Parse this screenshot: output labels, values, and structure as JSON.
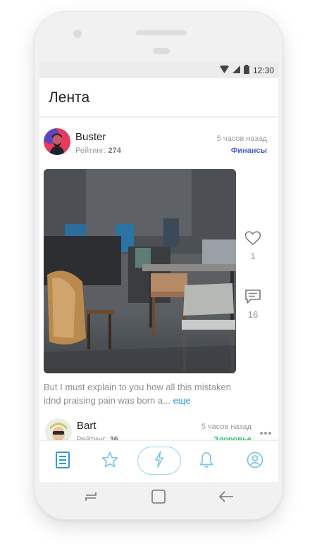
{
  "status": {
    "time": "12:30"
  },
  "header": {
    "title": "Лента"
  },
  "feed": {
    "posts": [
      {
        "author": "Buster",
        "rating_label": "Рейтинг:",
        "rating_value": "274",
        "time": "5 часов назад",
        "category": "Финансы",
        "category_color": "#4a5fd6",
        "likes": "1",
        "comments": "16",
        "excerpt": "But I must explain to you how all this mistaken idnd praising pain was born a...",
        "more": "еще"
      },
      {
        "author": "Bart",
        "rating_label": "Рейтинг:",
        "rating_value": "36",
        "time": "5 часов назад",
        "category": "Здоровье",
        "category_color": "#2ecc71"
      }
    ]
  },
  "tabbar": {
    "accent": "#2d9bd6",
    "inactive": "#7fc4e8",
    "items": [
      "feed-icon",
      "star-icon",
      "lightning-icon",
      "bell-icon",
      "profile-icon"
    ]
  }
}
